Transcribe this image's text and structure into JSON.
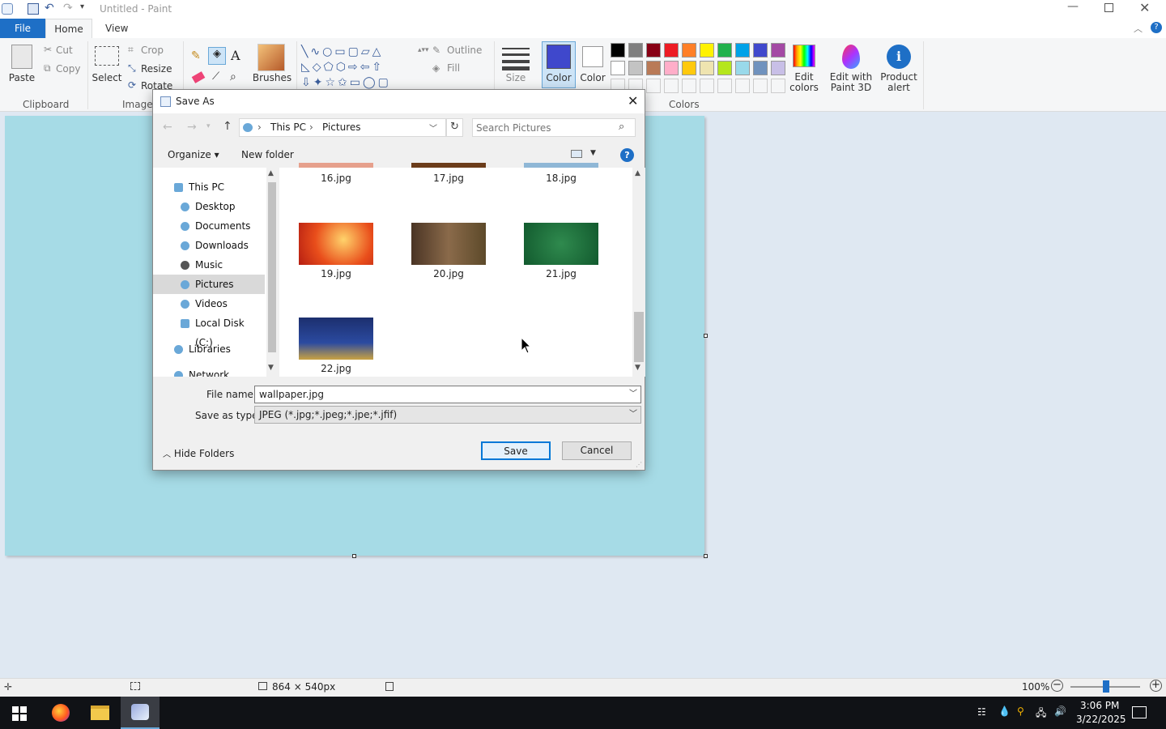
{
  "window": {
    "title": "Untitled - Paint"
  },
  "tabs": [
    "File",
    "Home",
    "View"
  ],
  "ribbon": {
    "clipboard": {
      "paste": "Paste",
      "cut": "Cut",
      "copy": "Copy",
      "group": "Clipboard"
    },
    "image": {
      "select": "Select",
      "crop": "Crop",
      "resize": "Resize",
      "rotate": "Rotate",
      "group": "Image"
    },
    "brushes": "Brushes",
    "shapes": {
      "outline": "Outline",
      "fill": "Fill"
    },
    "size": "Size",
    "color1": "Color 1",
    "color2": "Color 2",
    "colors_group": "Colors",
    "edit_colors": "Edit colors",
    "edit_paint3d": "Edit with Paint 3D",
    "product_alert": "Product alert",
    "palette_row1": [
      "#000000",
      "#7f7f7f",
      "#880015",
      "#ed1c24",
      "#ff7f27",
      "#fff200",
      "#22b14c",
      "#00a2e8",
      "#3f48cc",
      "#a349a4"
    ],
    "palette_row2": [
      "#ffffff",
      "#c3c3c3",
      "#b97a57",
      "#ffaec9",
      "#ffc90e",
      "#efe4b0",
      "#b5e61d",
      "#99d9ea",
      "#7092be",
      "#c8bfe7"
    ],
    "color1_value": "#3f48cc",
    "color2_value": "#ffffff"
  },
  "dialog": {
    "title": "Save As",
    "breadcrumb": [
      "This PC",
      "Pictures"
    ],
    "search_placeholder": "Search Pictures",
    "organize": "Organize",
    "new_folder": "New folder",
    "nav": [
      "This PC",
      "Desktop",
      "Documents",
      "Downloads",
      "Music",
      "Pictures",
      "Videos",
      "Local Disk (C:)",
      "Libraries",
      "Network"
    ],
    "nav_selected": "Pictures",
    "files": [
      "16.jpg",
      "17.jpg",
      "18.jpg",
      "19.jpg",
      "20.jpg",
      "21.jpg",
      "22.jpg"
    ],
    "file_name_label": "File name:",
    "file_name_value": "wallpaper.jpg",
    "save_type_label": "Save as type:",
    "save_type_value": "JPEG (*.jpg;*.jpeg;*.jpe;*.jfif)",
    "hide_folders": "Hide Folders",
    "save": "Save",
    "cancel": "Cancel"
  },
  "status": {
    "dimensions": "864 × 540px",
    "zoom": "100%"
  },
  "taskbar": {
    "time": "3:06 PM",
    "date": "3/22/2025"
  }
}
